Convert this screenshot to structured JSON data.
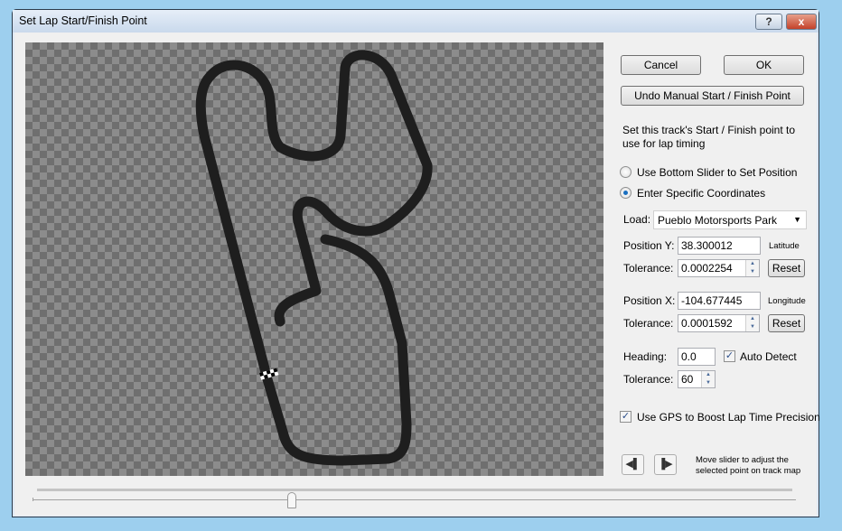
{
  "window": {
    "title": "Set Lap Start/Finish Point",
    "help_label": "?",
    "close_label": "x"
  },
  "buttons": {
    "cancel": "Cancel",
    "ok": "OK",
    "undo": "Undo Manual Start / Finish Point",
    "reset": "Reset"
  },
  "instructions": "Set this track's Start / Finish point to use for lap timing",
  "mode": {
    "options": [
      "Use Bottom Slider to Set Position",
      "Enter Specific Coordinates"
    ],
    "selected": 1
  },
  "load": {
    "label": "Load:",
    "value": "Pueblo Motorsports Park"
  },
  "position_y": {
    "label": "Position Y:",
    "value": "38.300012",
    "unit": "Latitude",
    "tolerance_label": "Tolerance:",
    "tolerance": "0.0002254"
  },
  "position_x": {
    "label": "Position X:",
    "value": "-104.677445",
    "unit": "Longitude",
    "tolerance_label": "Tolerance:",
    "tolerance": "0.0001592"
  },
  "heading": {
    "label": "Heading:",
    "value": "0.0",
    "auto_detect_label": "Auto Detect",
    "auto_detect": true,
    "tolerance_label": "Tolerance:",
    "tolerance": "60"
  },
  "gps_boost": {
    "label": "Use GPS to Boost Lap Time Precision",
    "checked": true
  },
  "nav": {
    "prev_icon": "step-back-icon",
    "next_icon": "step-forward-icon",
    "hint": "Move slider to adjust the selected point on track map"
  },
  "slider": {
    "position_fraction": 0.34
  },
  "colors": {
    "track": "#1e1e1e",
    "accent": "#1a6fc0"
  }
}
